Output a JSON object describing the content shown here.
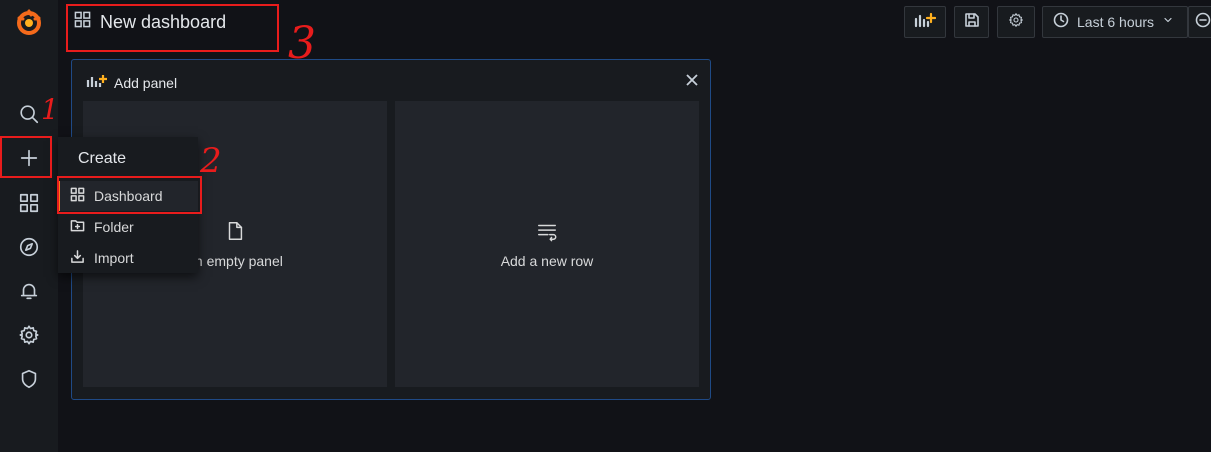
{
  "header": {
    "title": "New dashboard",
    "time_range": "Last 6 hours"
  },
  "add_panel": {
    "title": "Add panel",
    "options": [
      {
        "label": "an empty panel"
      },
      {
        "label": "Add a new row"
      }
    ]
  },
  "create_menu": {
    "header": "Create",
    "items": [
      {
        "label": "Dashboard",
        "icon": "grid-icon"
      },
      {
        "label": "Folder",
        "icon": "folder-plus-icon"
      },
      {
        "label": "Import",
        "icon": "import-icon"
      }
    ]
  },
  "annotations": [
    "1",
    "2",
    "3"
  ],
  "colors": {
    "background": "#111217",
    "sidebar": "#181b1f",
    "panel_border": "#1f4a86",
    "accent_orange": "#ff7a1a",
    "annotation_red": "#e81c1c"
  }
}
